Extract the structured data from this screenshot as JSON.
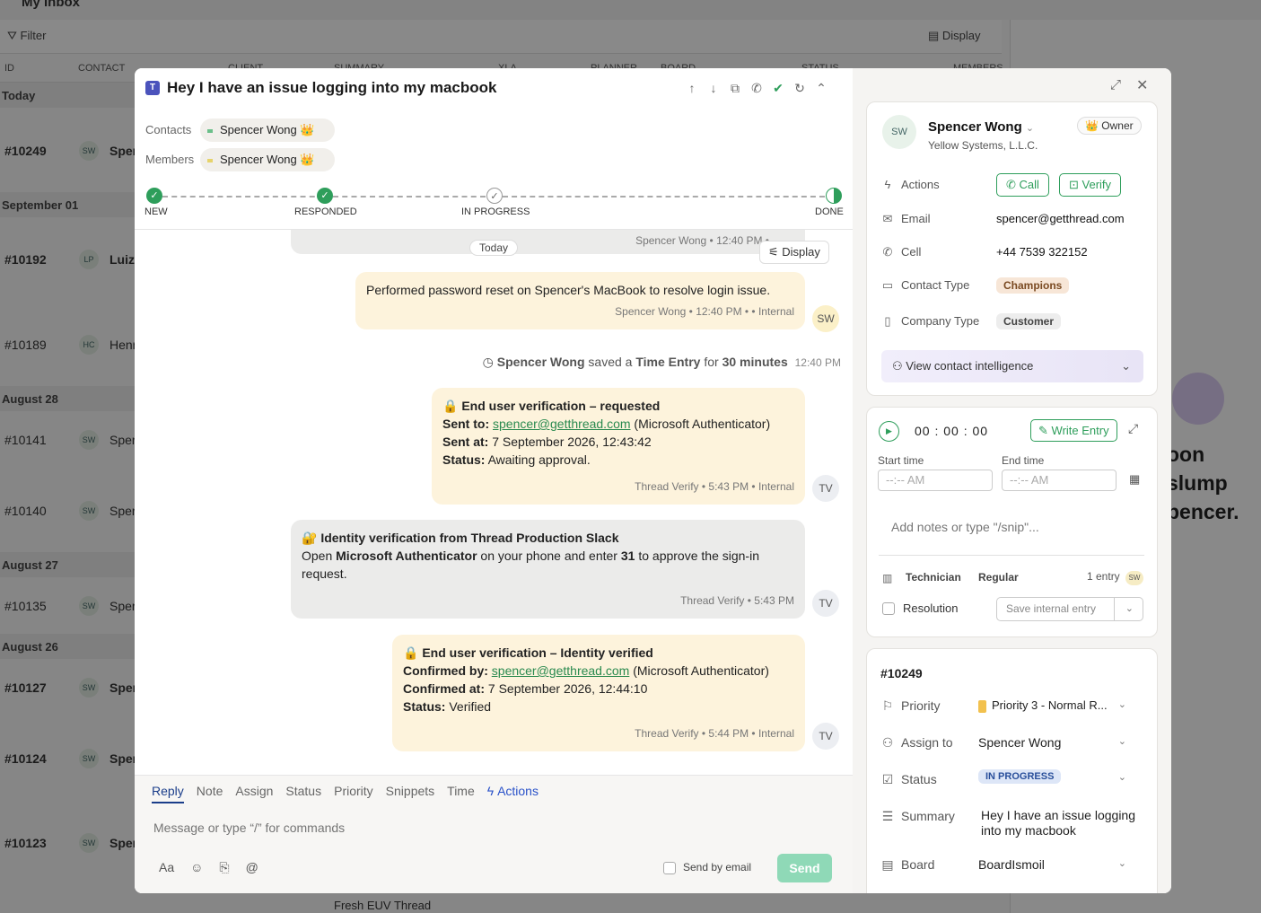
{
  "background": {
    "page_title": "My Inbox",
    "filter_label": "Filter",
    "display_label": "Display",
    "columns": [
      "ID",
      "CONTACT",
      "CLIENT",
      "SUMMARY",
      "XLA",
      "PLANNER",
      "BOARD",
      "STATUS",
      "MEMBERS"
    ],
    "sections": [
      {
        "label": "Today"
      },
      {
        "label": "September 01"
      },
      {
        "label": "August 28"
      },
      {
        "label": "August 27"
      },
      {
        "label": "August 26"
      }
    ],
    "rows": [
      {
        "id": "#10249",
        "avatar": "SW",
        "name": "Sper"
      },
      {
        "id": "#10192",
        "avatar": "LP",
        "name": "Luiz"
      },
      {
        "id": "#10189",
        "avatar": "HC",
        "name": "Henr"
      },
      {
        "id": "#10141",
        "avatar": "SW",
        "name": "Sper"
      },
      {
        "id": "#10140",
        "avatar": "SW",
        "name": "Sper"
      },
      {
        "id": "#10135",
        "avatar": "SW",
        "name": "Sper"
      },
      {
        "id": "#10127",
        "avatar": "SW",
        "name": "Sper"
      },
      {
        "id": "#10124",
        "avatar": "SW",
        "name": "Sper"
      },
      {
        "id": "#10123",
        "avatar": "SW",
        "name": "Sper"
      }
    ],
    "bottom_summary": "Fresh EUV Thread",
    "right_text_line1": "oon slump",
    "right_text_line2": "pencer."
  },
  "ticket": {
    "title": "Hey I have an issue logging into my macbook",
    "contacts_label": "Contacts",
    "members_label": "Members",
    "contact_name": "Spencer Wong 👑",
    "member_name": "Spencer Wong 👑",
    "steps": [
      "NEW",
      "RESPONDED",
      "IN PROGRESS",
      "DONE"
    ]
  },
  "thread": {
    "prev_meta": "Spencer Wong • 12:40 PM •",
    "today_label": "Today",
    "display_btn": "Display",
    "messages": [
      {
        "text": "Performed password reset on Spencer's MacBook to resolve login issue.",
        "meta": "Spencer Wong • 12:40 PM •  • Internal",
        "avatar": "SW"
      },
      {
        "title": "🔒 End user verification – requested",
        "sent_to_label": "Sent to:",
        "sent_to": "spencer@getthread.com",
        "sent_to_suffix": "(Microsoft Authenticator)",
        "sent_at_label": "Sent at:",
        "sent_at": "7 September 2026, 12:43:42",
        "status_label": "Status:",
        "status": "Awaiting approval.",
        "meta": "Thread Verify • 5:43 PM • Internal",
        "avatar": "TV"
      },
      {
        "title": "🔐 Identity verification from Thread Production Slack",
        "line_a": "Open",
        "app": "Microsoft Authenticator",
        "line_b": "on your phone and enter",
        "code": "31",
        "line_c": "to approve the sign-in request.",
        "meta": "Thread Verify • 5:43 PM",
        "avatar": "TV"
      },
      {
        "title": "🔒 End user verification – Identity verified",
        "confirmed_by_label": "Confirmed by:",
        "confirmed_by": "spencer@getthread.com",
        "confirmed_by_suffix": "(Microsoft Authenticator)",
        "confirmed_at_label": "Confirmed at:",
        "confirmed_at": "7 September 2026, 12:44:10",
        "status_label": "Status:",
        "status": "Verified",
        "meta": "Thread Verify • 5:44 PM • Internal",
        "avatar": "TV"
      }
    ],
    "time_entry": {
      "who": "Spencer Wong",
      "saved": "saved a",
      "what": "Time Entry",
      "for": "for",
      "duration": "30 minutes",
      "time": "12:40 PM"
    }
  },
  "composer": {
    "tabs": [
      "Reply",
      "Note",
      "Assign",
      "Status",
      "Priority",
      "Snippets",
      "Time",
      "Actions"
    ],
    "placeholder": "Message or type “/” for commands",
    "send_by_email": "Send by email",
    "send": "Send"
  },
  "contact": {
    "initials": "SW",
    "name": "Spencer Wong",
    "company": "Yellow Systems, L.L.C.",
    "role": "👑 Owner",
    "actions_label": "Actions",
    "call": "Call",
    "verify": "Verify",
    "email_label": "Email",
    "email": "spencer@getthread.com",
    "cell_label": "Cell",
    "cell": "+44 7539 322152",
    "contact_type_label": "Contact Type",
    "contact_type": "Champions",
    "company_type_label": "Company Type",
    "company_type": "Customer",
    "intel": "View contact intelligence"
  },
  "time": {
    "timer": "00 : 00 : 00",
    "write_entry": "Write Entry",
    "start_label": "Start time",
    "end_label": "End time",
    "start_placeholder": "--:-- AM",
    "end_placeholder": "--:-- AM",
    "notes_placeholder": "Add notes or type \"/snip\"...",
    "technician_label": "Technician",
    "technician_value": "Regular",
    "entries": "1 entry",
    "entries_avatar": "SW",
    "resolution": "Resolution",
    "save_internal": "Save internal entry"
  },
  "details": {
    "id": "#10249",
    "priority_label": "Priority",
    "priority": "Priority 3 - Normal R...",
    "assign_label": "Assign to",
    "assign": "Spencer Wong",
    "status_label": "Status",
    "status": "IN PROGRESS",
    "summary_label": "Summary",
    "summary": "Hey I have an issue logging into my macbook",
    "board_label": "Board",
    "board": "BoardIsmoil"
  },
  "colors": {
    "accent": "#2e9e5b",
    "internal_bubble": "#fdf3dc",
    "verify_bubble": "#ebebea",
    "status_pill": "#dde6f7",
    "priority_flag": "#f2c14e"
  }
}
